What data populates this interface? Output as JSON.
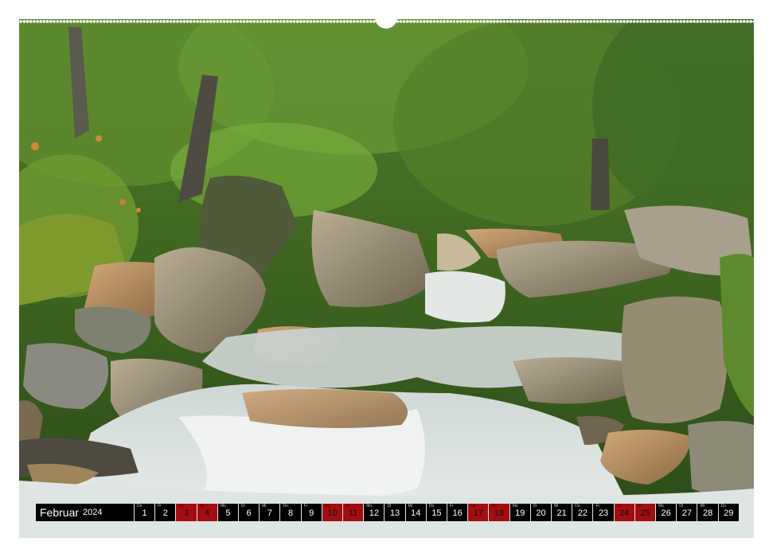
{
  "photo": {
    "subject": "mountain stream cascading over rocks in a green forest"
  },
  "calendar": {
    "month": "Februar",
    "year": "2024",
    "colors": {
      "strip": "#000000",
      "weekend": "#a30c10",
      "text": "#ffffff"
    },
    "days": [
      {
        "num": "1",
        "dow": "Do",
        "weekend": false
      },
      {
        "num": "2",
        "dow": "Fr",
        "weekend": false
      },
      {
        "num": "3",
        "dow": "Sa",
        "weekend": true
      },
      {
        "num": "4",
        "dow": "So",
        "weekend": true
      },
      {
        "num": "5",
        "dow": "Mo",
        "weekend": false
      },
      {
        "num": "6",
        "dow": "Di",
        "weekend": false
      },
      {
        "num": "7",
        "dow": "Mi",
        "weekend": false
      },
      {
        "num": "8",
        "dow": "Do",
        "weekend": false
      },
      {
        "num": "9",
        "dow": "Fr",
        "weekend": false
      },
      {
        "num": "10",
        "dow": "Sa",
        "weekend": true
      },
      {
        "num": "11",
        "dow": "So",
        "weekend": true
      },
      {
        "num": "12",
        "dow": "Mo",
        "weekend": false
      },
      {
        "num": "13",
        "dow": "Di",
        "weekend": false
      },
      {
        "num": "14",
        "dow": "Mi",
        "weekend": false
      },
      {
        "num": "15",
        "dow": "Do",
        "weekend": false
      },
      {
        "num": "16",
        "dow": "Fr",
        "weekend": false
      },
      {
        "num": "17",
        "dow": "Sa",
        "weekend": true
      },
      {
        "num": "18",
        "dow": "So",
        "weekend": true
      },
      {
        "num": "19",
        "dow": "Mo",
        "weekend": false
      },
      {
        "num": "20",
        "dow": "Di",
        "weekend": false
      },
      {
        "num": "21",
        "dow": "Mi",
        "weekend": false
      },
      {
        "num": "22",
        "dow": "Do",
        "weekend": false
      },
      {
        "num": "23",
        "dow": "Fr",
        "weekend": false
      },
      {
        "num": "24",
        "dow": "Sa",
        "weekend": true
      },
      {
        "num": "25",
        "dow": "So",
        "weekend": true
      },
      {
        "num": "26",
        "dow": "Mo",
        "weekend": false
      },
      {
        "num": "27",
        "dow": "Di",
        "weekend": false
      },
      {
        "num": "28",
        "dow": "Mi",
        "weekend": false
      },
      {
        "num": "29",
        "dow": "Do",
        "weekend": false
      }
    ]
  }
}
